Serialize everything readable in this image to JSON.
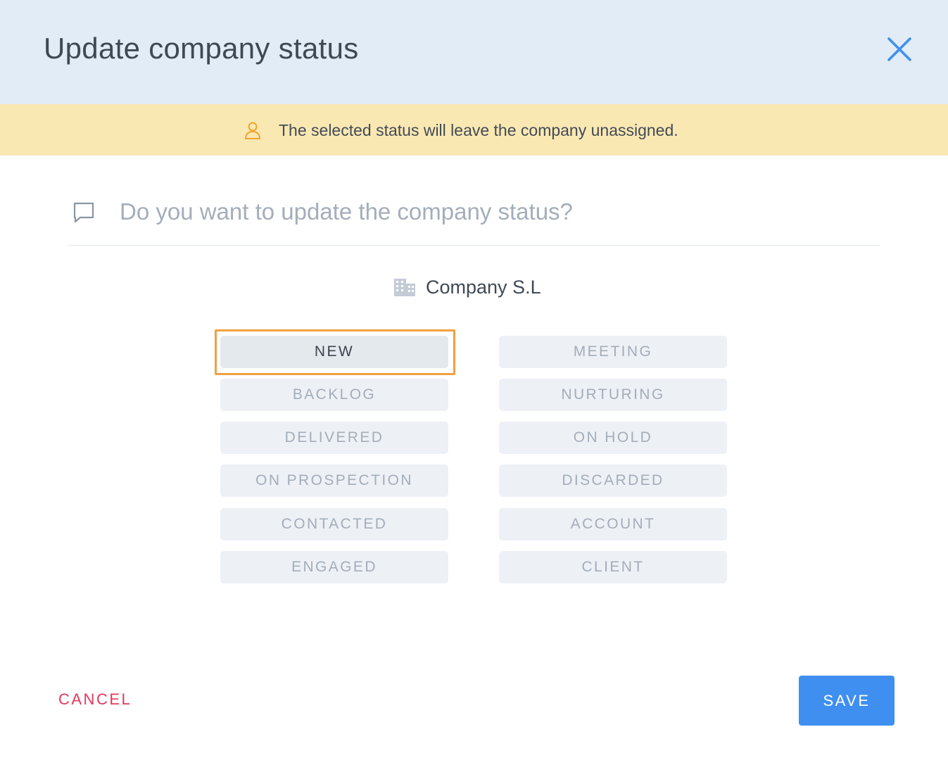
{
  "dialog": {
    "title": "Update company status",
    "close_icon": "close-icon"
  },
  "banner": {
    "icon": "person-icon",
    "text": "The selected status will leave the company unassigned.",
    "background": "#fae8b3",
    "icon_color": "#f0a52e"
  },
  "question": {
    "icon": "message-icon",
    "text": "Do you want to update the company status?"
  },
  "company": {
    "icon": "building-icon",
    "name": "Company S.L"
  },
  "statuses": {
    "selected": "NEW",
    "left": [
      "NEW",
      "BACKLOG",
      "DELIVERED",
      "ON PROSPECTION",
      "CONTACTED",
      "ENGAGED"
    ],
    "right": [
      "MEETING",
      "NURTURING",
      "ON HOLD",
      "DISCARDED",
      "ACCOUNT",
      "CLIENT"
    ]
  },
  "footer": {
    "cancel_label": "CANCEL",
    "save_label": "SAVE"
  },
  "colors": {
    "header_bg": "#e2ecf6",
    "accent": "#3f8ff0",
    "cancel": "#e3385a",
    "selection_outline": "#f0a140"
  }
}
